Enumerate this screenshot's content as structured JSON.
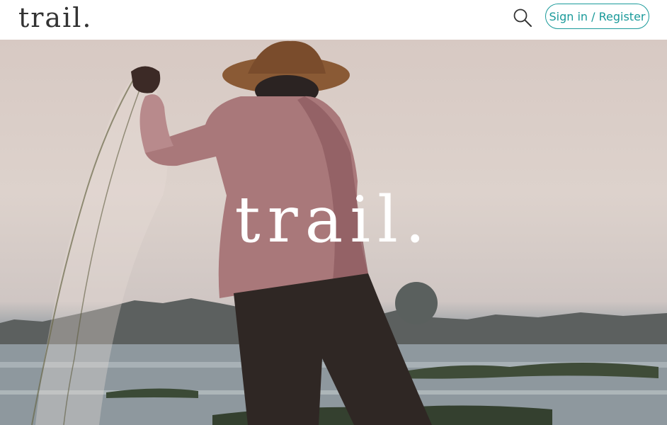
{
  "header": {
    "logo": "trail.",
    "search_icon": "search-icon",
    "signin_label": "Sign in / Register"
  },
  "hero": {
    "title": "trail.",
    "colors": {
      "accent": "#1a9a9a",
      "sky": "#d7c9c3",
      "water": "#8d969c"
    }
  }
}
